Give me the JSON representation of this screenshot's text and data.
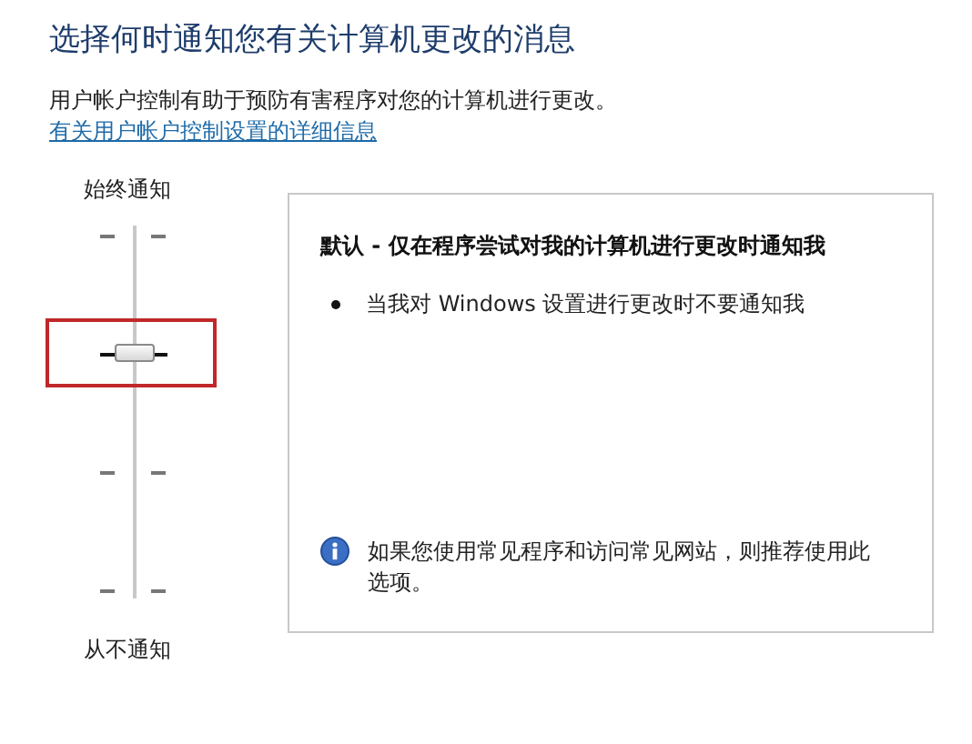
{
  "title": "选择何时通知您有关计算机更改的消息",
  "description": "用户帐户控制有助于预防有害程序对您的计算机进行更改。",
  "link": "有关用户帐户控制设置的详细信息",
  "slider": {
    "top_label": "始终通知",
    "bottom_label": "从不通知",
    "level": 0.67,
    "highlighted": true
  },
  "panel": {
    "heading": "默认 - 仅在程序尝试对我的计算机进行更改时通知我",
    "bullets": [
      "当我对 Windows 设置进行更改时不要通知我"
    ],
    "note": "如果您使用常见程序和访问常见网站，则推荐使用此选项。"
  }
}
